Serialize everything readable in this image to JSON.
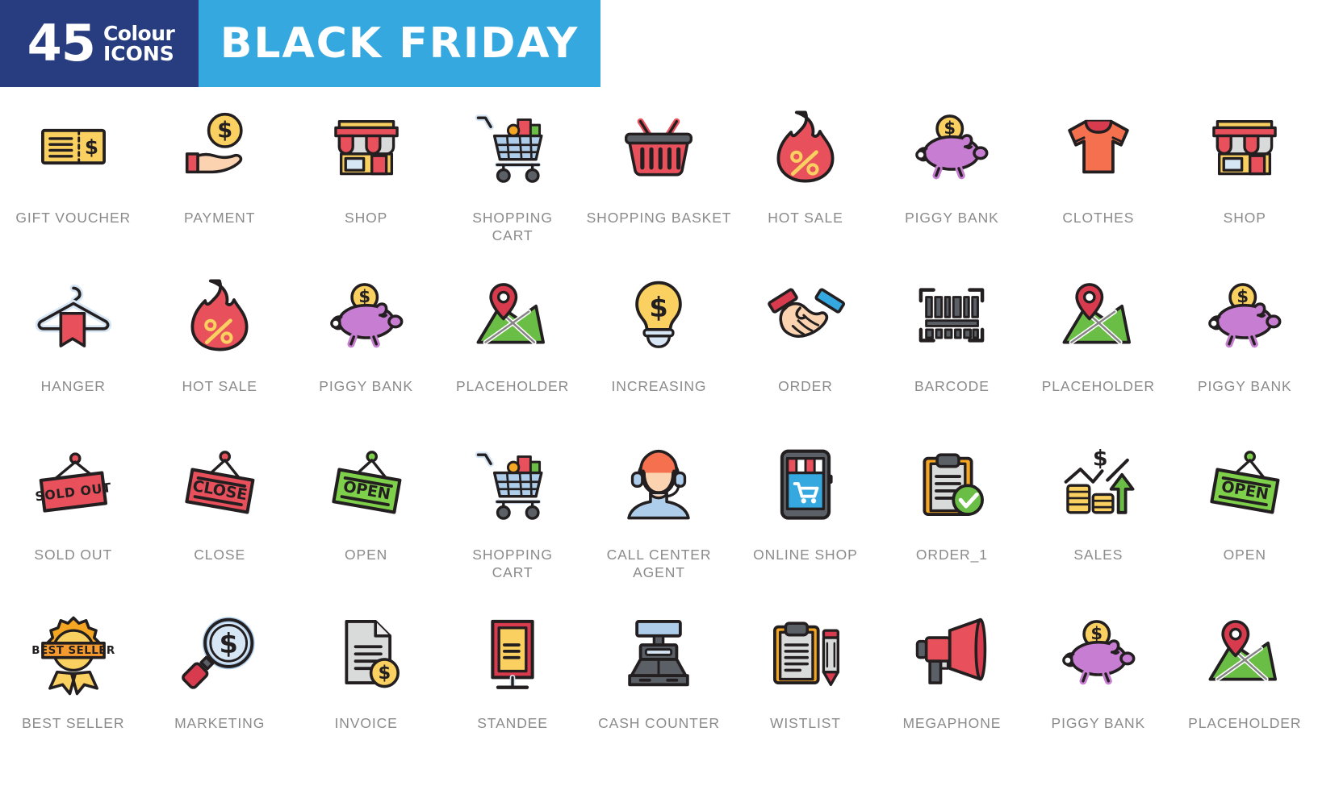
{
  "header": {
    "badge_number": "45",
    "badge_word1": "Colour",
    "badge_word2": "ICONS",
    "title": "BLACK FRIDAY",
    "badge_bg": "#283c80",
    "title_bg": "#35a8e0",
    "title_color": "#ffffff"
  },
  "palette": {
    "outline": "#231f20",
    "red": "#e8505b",
    "crimson": "#d83a4e",
    "coral": "#f4704f",
    "yellow": "#fad061",
    "amber": "#f5a623",
    "orange": "#f59a2e",
    "purple": "#c77dd1",
    "green": "#6abd45",
    "light_green": "#7ed04b",
    "blue": "#35a8e0",
    "light_blue": "#aecdea",
    "pale_blue": "#d7e6f5",
    "grey": "#d9dada",
    "dark_grey": "#5b6066",
    "skin": "#fbd3b0",
    "label_color": "#8b8b8b"
  },
  "grid": {
    "columns": 9,
    "rows": 4,
    "total_icons": 36
  },
  "icons": [
    {
      "id": "gift-voucher",
      "label": "GIFT VOUCHER"
    },
    {
      "id": "payment",
      "label": "PAYMENT"
    },
    {
      "id": "shop",
      "label": "SHOP"
    },
    {
      "id": "shopping-cart",
      "label": "SHOPPING\nCART"
    },
    {
      "id": "shopping-basket",
      "label": "SHOPPING BASKET"
    },
    {
      "id": "hot-sale",
      "label": "HOT SALE"
    },
    {
      "id": "piggy-bank",
      "label": "PIGGY BANK"
    },
    {
      "id": "clothes",
      "label": "CLOTHES"
    },
    {
      "id": "shop-2",
      "label": "SHOP"
    },
    {
      "id": "hanger",
      "label": "HANGER"
    },
    {
      "id": "hot-sale-2",
      "label": "HOT SALE"
    },
    {
      "id": "piggy-bank-2",
      "label": "PIGGY BANK"
    },
    {
      "id": "placeholder",
      "label": "PLACEHOLDER"
    },
    {
      "id": "increasing",
      "label": "INCREASING"
    },
    {
      "id": "order",
      "label": "ORDER"
    },
    {
      "id": "barcode",
      "label": "BARCODE"
    },
    {
      "id": "placeholder-2",
      "label": "PLACEHOLDER"
    },
    {
      "id": "piggy-bank-3",
      "label": "PIGGY BANK"
    },
    {
      "id": "sold-out",
      "label": "SOLD OUT"
    },
    {
      "id": "close",
      "label": "CLOSE"
    },
    {
      "id": "open",
      "label": "OPEN"
    },
    {
      "id": "shopping-cart-2",
      "label": "SHOPPING\nCART"
    },
    {
      "id": "call-center-agent",
      "label": "CALL CENTER AGENT"
    },
    {
      "id": "online-shop",
      "label": "ONLINE SHOP"
    },
    {
      "id": "order-1",
      "label": "ORDER_1"
    },
    {
      "id": "sales",
      "label": "SALES"
    },
    {
      "id": "open-2",
      "label": "OPEN"
    },
    {
      "id": "best-seller",
      "label": "BEST SELLER"
    },
    {
      "id": "marketing",
      "label": "MARKETING"
    },
    {
      "id": "invoice",
      "label": "INVOICE"
    },
    {
      "id": "standee",
      "label": "STANDEE"
    },
    {
      "id": "cash-counter",
      "label": "CASH COUNTER"
    },
    {
      "id": "wistlist",
      "label": "WISTLIST"
    },
    {
      "id": "megaphone",
      "label": "MEGAPHONE"
    },
    {
      "id": "piggy-bank-4",
      "label": "PIGGY BANK"
    },
    {
      "id": "placeholder-3",
      "label": "PLACEHOLDER"
    }
  ],
  "icon_text": {
    "sold_out_sign": "SOLD OUT",
    "close_sign": "CLOSE",
    "open_sign": "OPEN",
    "best_seller_ribbon": "BEST SELLER",
    "dollar_symbol": "$",
    "percent_symbol": "%"
  }
}
